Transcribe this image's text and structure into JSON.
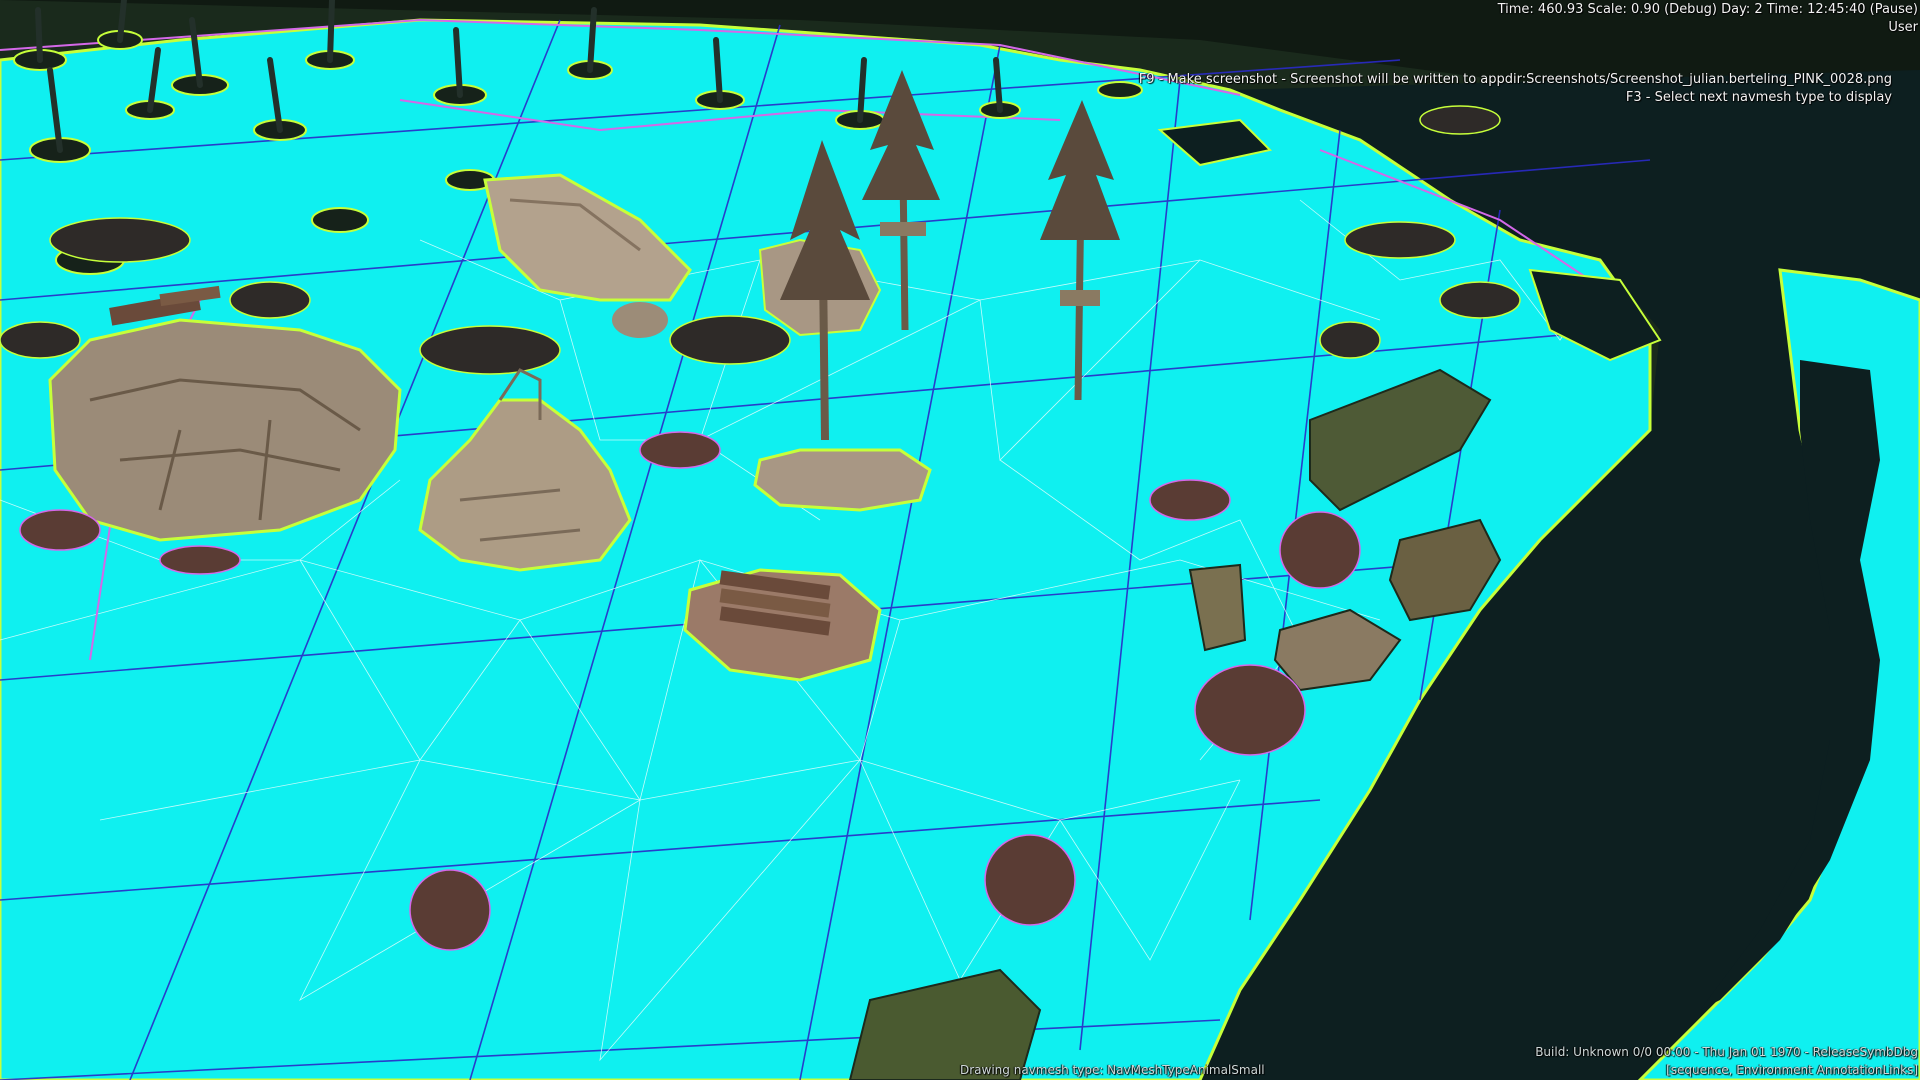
{
  "hud": {
    "status": "Time: 460.93 Scale: 0.90 (Debug)  Day: 2 Time: 12:45:40 (Pause)",
    "user": "User",
    "hint_screenshot": "F9 - Make screenshot - Screenshot will be written to appdir:Screenshots/Screenshot_julian.berteling_PINK_0028.png",
    "hint_navmesh": "F3 - Select next navmesh type to display",
    "drawing_navmesh": "Drawing navmesh type: NavMeshTypeAnimalSmall",
    "build_line1": "Build: Unknown 0/0 00:00 - Thu Jan 01 1970 - ReleaseSymbDbg",
    "build_line2": "[sequence, Environment AnnotationLinks]"
  },
  "colors": {
    "navmesh": "#0ff0f0",
    "navmesh_outline": "#c6ff3a",
    "grid_line": "#2a2ac8",
    "triangle_line": "#ffffff",
    "water": "#0d1f20",
    "forest": "#1a2a1c",
    "rock": "#9b8b78",
    "shrub": "#4a3a36",
    "tree_trunk": "#6a5a48"
  },
  "scene": {
    "objects": [
      {
        "name": "large-rock-left",
        "kind": "rock"
      },
      {
        "name": "rock-with-fallen-log",
        "kind": "rock"
      },
      {
        "name": "boulder-top-center",
        "kind": "rock"
      },
      {
        "name": "rock-pile-center",
        "kind": "rock"
      },
      {
        "name": "low-rock-with-tree",
        "kind": "rock"
      },
      {
        "name": "log-pile-rock",
        "kind": "rock"
      },
      {
        "name": "mossy-slab-right",
        "kind": "rock"
      },
      {
        "name": "tall-pine-center",
        "kind": "tree"
      },
      {
        "name": "pine-with-platform",
        "kind": "tree"
      },
      {
        "name": "river",
        "kind": "water"
      }
    ]
  }
}
